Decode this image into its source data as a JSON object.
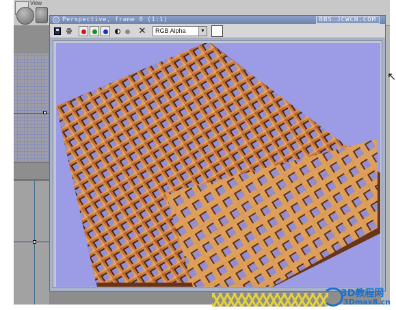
{
  "window": {
    "title": "Perspective, frame 0 (1:1)",
    "watermark": "BBS.JCWCN.COM"
  },
  "toolbar": {
    "save_icon": "save-icon",
    "clone_icon": "clone-icon",
    "channels": [
      {
        "name": "red-channel-icon",
        "color": "#d01818"
      },
      {
        "name": "green-channel-icon",
        "color": "#14901e"
      },
      {
        "name": "blue-channel-icon",
        "color": "#1c30c8"
      }
    ],
    "alpha_icon": "alpha-channel-icon",
    "mono_icon": "monochrome-icon",
    "clear_icon": "clear-icon",
    "channel_select": "RGB Alpha",
    "swatch_color": "#ffffff"
  },
  "render": {
    "background": "#9b9be6",
    "lattice_color": "#c8783c",
    "lattice_shadow": "#5a2a10"
  },
  "app": {
    "viewport_top_label": "View"
  },
  "logo": {
    "line1": "3D教程网",
    "line2": "3Dmax8.cn"
  }
}
